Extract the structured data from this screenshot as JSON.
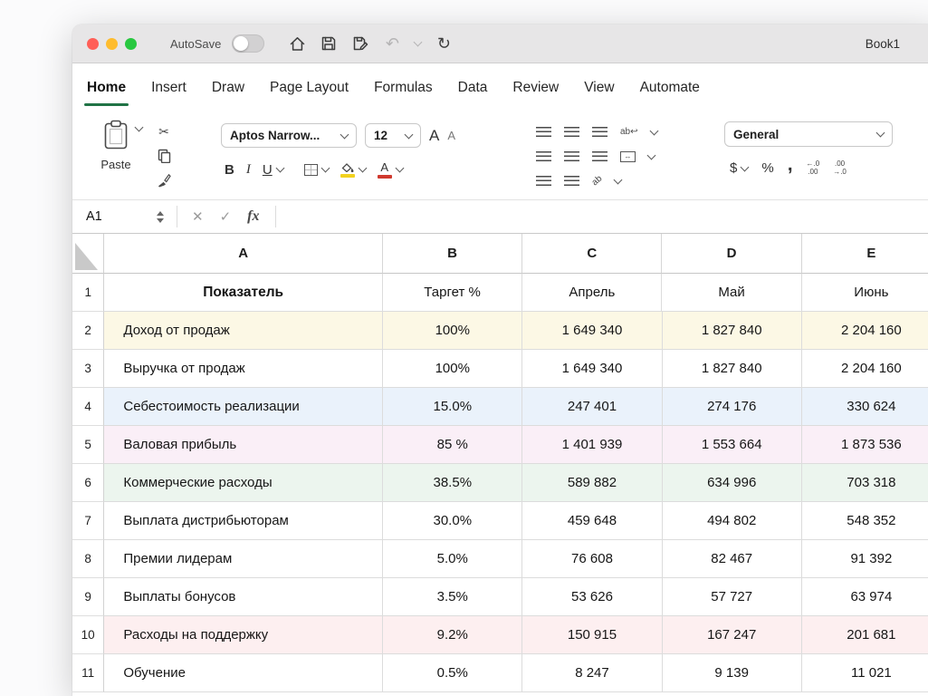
{
  "titlebar": {
    "autosave_label": "AutoSave",
    "workbook_title": "Book1"
  },
  "tabs": [
    {
      "label": "Home",
      "active": true
    },
    {
      "label": "Insert"
    },
    {
      "label": "Draw"
    },
    {
      "label": "Page Layout"
    },
    {
      "label": "Formulas"
    },
    {
      "label": "Data"
    },
    {
      "label": "Review"
    },
    {
      "label": "View"
    },
    {
      "label": "Automate"
    }
  ],
  "ribbon": {
    "paste_label": "Paste",
    "font_name": "Aptos Narrow...",
    "font_size": "12",
    "font_increase": "A",
    "font_decrease": "A",
    "bold": "B",
    "italic": "I",
    "underline": "U",
    "font_color_letter": "A",
    "wrap_text": "ab",
    "wrap_arrow": "↩",
    "orientation": "ab",
    "merge_glyph": "↔",
    "number_format": "General",
    "currency": "$",
    "percent": "%",
    "comma_style": ",",
    "dec_inc_top": "←.0",
    "dec_inc_bottom": ".00",
    "dec_dec_top": ".00",
    "dec_dec_bottom": "→.0"
  },
  "formula_bar": {
    "cell_ref": "A1",
    "cancel": "✕",
    "enter": "✓",
    "fx": "fx"
  },
  "icons": {
    "scissors": "✂",
    "undo": "↶",
    "redo": "↻"
  },
  "grid": {
    "columns": [
      "A",
      "B",
      "C",
      "D",
      "E"
    ],
    "rows": [
      {
        "num": "1",
        "first": true,
        "bg": "#ffffff",
        "cells": [
          "Показатель",
          "Таргет %",
          "Апрель",
          "Май",
          "Июнь"
        ]
      },
      {
        "num": "2",
        "bg": "#fcf8e5",
        "cells": [
          "Доход от продаж",
          "100%",
          "1 649 340",
          "1 827 840",
          "2 204 160"
        ]
      },
      {
        "num": "3",
        "bg": "#ffffff",
        "cells": [
          "Выручка от продаж",
          "100%",
          "1 649 340",
          "1 827 840",
          "2 204 160"
        ]
      },
      {
        "num": "4",
        "bg": "#eaf2fb",
        "cells": [
          "Себестоимость реализации",
          "15.0%",
          "247 401",
          "274 176",
          "330 624"
        ]
      },
      {
        "num": "5",
        "bg": "#faeff7",
        "cells": [
          "Валовая прибыль",
          "85 %",
          "1 401 939",
          "1 553 664",
          "1 873 536"
        ]
      },
      {
        "num": "6",
        "bg": "#ecf5ee",
        "cells": [
          "Коммерческие расходы",
          "38.5%",
          "589 882",
          "634 996",
          "703 318"
        ]
      },
      {
        "num": "7",
        "bg": "#ffffff",
        "cells": [
          "Выплата дистрибьюторам",
          "30.0%",
          "459 648",
          "494 802",
          "548 352"
        ]
      },
      {
        "num": "8",
        "bg": "#ffffff",
        "cells": [
          "Премии лидерам",
          "5.0%",
          "76 608",
          "82 467",
          "91 392"
        ]
      },
      {
        "num": "9",
        "bg": "#ffffff",
        "cells": [
          "Выплаты бонусов",
          "3.5%",
          "53 626",
          "57 727",
          "63 974"
        ]
      },
      {
        "num": "10",
        "bg": "#fdeff0",
        "cells": [
          "Расходы на поддержку",
          "9.2%",
          "150 915",
          "167 247",
          "201 681"
        ]
      },
      {
        "num": "11",
        "bg": "#ffffff",
        "cells": [
          "Обучение",
          "0.5%",
          "8 247",
          "9 139",
          "11 021"
        ]
      }
    ]
  },
  "colors": {
    "tab_accent": "#217346",
    "traffic_red": "#ff5f57",
    "traffic_yellow": "#febc2e",
    "traffic_green": "#28c840",
    "fill_yellow": "#f2d21f",
    "font_red": "#d0392e"
  }
}
